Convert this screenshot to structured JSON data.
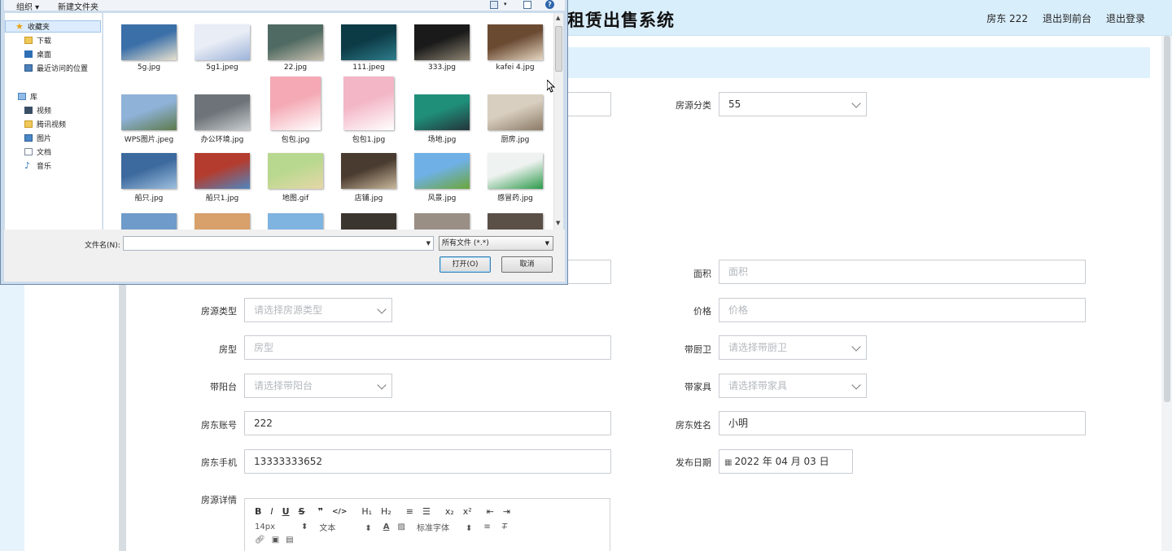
{
  "app": {
    "title": "租赁出售系统",
    "nav": [
      "房东 222",
      "退出到前台",
      "退出登录"
    ]
  },
  "form": {
    "category": {
      "label": "房源分类",
      "value": "55"
    },
    "area": {
      "label": "面积",
      "placeholder": "面积"
    },
    "house_type_kind": {
      "label": "房源类型",
      "placeholder": "请选择房源类型"
    },
    "price": {
      "label": "价格",
      "placeholder": "价格"
    },
    "layout": {
      "label": "房型",
      "placeholder": "房型"
    },
    "kitchen_bath": {
      "label": "带厨卫",
      "placeholder": "请选择带厨卫"
    },
    "balcony": {
      "label": "带阳台",
      "placeholder": "请选择带阳台"
    },
    "furniture": {
      "label": "带家具",
      "placeholder": "请选择带家具"
    },
    "landlord_account": {
      "label": "房东账号",
      "value": "222"
    },
    "landlord_name": {
      "label": "房东姓名",
      "value": "小明"
    },
    "landlord_phone": {
      "label": "房东手机",
      "value": "13333333652"
    },
    "publish_date": {
      "label": "发布日期",
      "value": "2022 年 04 月 03 日"
    },
    "details": {
      "label": "房源详情"
    }
  },
  "editor": {
    "row1": [
      "B",
      "I",
      "U",
      "S",
      "❞",
      "</>",
      "H₁",
      "H₂",
      "≡",
      "☰",
      "x₂",
      "x²",
      "⇤",
      "⇥"
    ],
    "font_size": "14px",
    "text_style": "文本",
    "font_family": "标准字体"
  },
  "dialog": {
    "toolbar": {
      "organize": "组织 ▾",
      "new_folder": "新建文件夹"
    },
    "nav": {
      "favorites": "收藏夹",
      "downloads": "下载",
      "desktop": "桌面",
      "recent": "最近访问的位置",
      "libraries": "库",
      "videos": "视频",
      "tencent_video": "腾讯视频",
      "pictures": "图片",
      "documents": "文档",
      "music": "音乐"
    },
    "files": [
      {
        "name": "5g.jpg",
        "colors": [
          "#3a6fa8",
          "#e8e2d0"
        ]
      },
      {
        "name": "5g1.jpeg",
        "colors": [
          "#e9edf6",
          "#9db3d8"
        ]
      },
      {
        "name": "22.jpg",
        "colors": [
          "#4f6a62",
          "#c8c0b0"
        ]
      },
      {
        "name": "111.jpeg",
        "colors": [
          "#0c3b46",
          "#2f7d8c"
        ]
      },
      {
        "name": "333.jpg",
        "colors": [
          "#1a1a1a",
          "#8d8472"
        ]
      },
      {
        "name": "kafei 4.jpg",
        "colors": [
          "#6b4a32",
          "#e7d8c3"
        ]
      },
      {
        "name": "WPS图片.jpeg",
        "colors": [
          "#8fb2d8",
          "#5d7a4a"
        ]
      },
      {
        "name": "办公环境.jpg",
        "colors": [
          "#6d7378",
          "#c9ced1"
        ]
      },
      {
        "name": "包包.jpg",
        "colors": [
          "#f4a9b4",
          "#ffffff"
        ]
      },
      {
        "name": "包包1.jpg",
        "colors": [
          "#f3b6c6",
          "#ffffff"
        ]
      },
      {
        "name": "场地.jpg",
        "colors": [
          "#1f8f7a",
          "#24343a"
        ]
      },
      {
        "name": "厨房.jpg",
        "colors": [
          "#d9cfc0",
          "#8b7a66"
        ]
      },
      {
        "name": "船只.jpg",
        "colors": [
          "#3d6a9e",
          "#9fc0df"
        ]
      },
      {
        "name": "船只1.jpg",
        "colors": [
          "#b43c2e",
          "#4f86c0"
        ]
      },
      {
        "name": "地图.gif",
        "colors": [
          "#b9d88f",
          "#e6d7a8"
        ]
      },
      {
        "name": "店铺.jpg",
        "colors": [
          "#4a3b30",
          "#c9b89c"
        ]
      },
      {
        "name": "风景.jpg",
        "colors": [
          "#6fb1e6",
          "#6ca63a"
        ]
      },
      {
        "name": "感冒药.jpg",
        "colors": [
          "#eef2f0",
          "#2c9a4a"
        ]
      }
    ],
    "filename_label": "文件名(N):",
    "filetype": "所有文件 (*.*)",
    "open_button": "打开(O)",
    "cancel_button": "取消"
  }
}
